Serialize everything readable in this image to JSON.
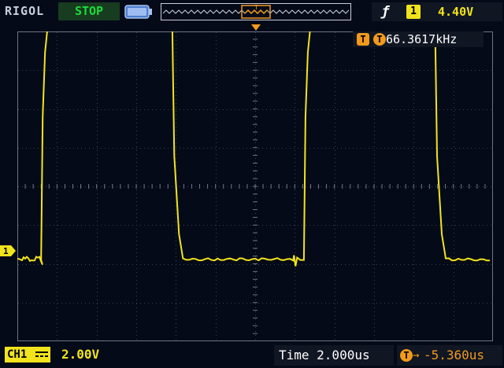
{
  "header": {
    "brand": "RIGOL",
    "run_status": "STOP",
    "trigger_edge_icon": "rising-edge-icon",
    "trigger_channel": "1",
    "trigger_level": "4.40V"
  },
  "trigger_marker_label": "T",
  "frequency": {
    "prefix": "T",
    "value": "66.3617kHz"
  },
  "channel_marker": "1",
  "footer": {
    "channel_label": "CH1",
    "coupling_icon": "dc-coupling-icon",
    "channel_scale": "2.00V",
    "timebase": "Time 2.000us",
    "trigger_offset_prefix": "T",
    "trigger_offset_arrow": "→",
    "trigger_offset": "-5.360us"
  },
  "colors": {
    "background": "#050a18",
    "trace": "#f1e41c",
    "grid": "#3b4354",
    "status_green": "#1cdb3a",
    "trigger_orange": "#f19a1c"
  },
  "grid": {
    "hdiv": 12,
    "vdiv": 8
  },
  "waveform": {
    "description_units": "divisions",
    "baseline_div": -1.9,
    "high_div": 4.8,
    "period_div": 6.63,
    "rise_start_div": 0.6,
    "fall_start_div": 3.9
  }
}
